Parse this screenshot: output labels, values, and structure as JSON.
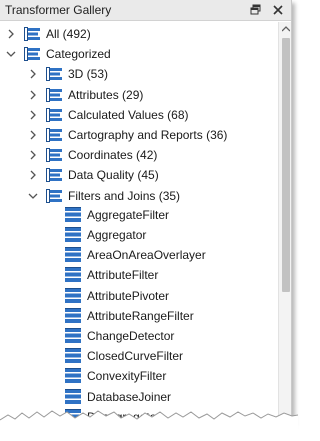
{
  "window": {
    "title": "Transformer Gallery",
    "pin_icon": "pin-icon",
    "close_icon": "close-icon"
  },
  "colors": {
    "icon_blue": "#2f72c4",
    "icon_dark": "#1d4f8e",
    "chevron": "#555555",
    "titlebar_bg": "#eaeaea"
  },
  "tree": {
    "all": {
      "label": "All (492)",
      "expanded": false
    },
    "categorized": {
      "label": "Categorized",
      "expanded": true,
      "categories": [
        {
          "label": "3D (53)",
          "expanded": false
        },
        {
          "label": "Attributes (29)",
          "expanded": false
        },
        {
          "label": "Calculated Values (68)",
          "expanded": false
        },
        {
          "label": "Cartography and Reports (36)",
          "expanded": false
        },
        {
          "label": "Coordinates (42)",
          "expanded": false
        },
        {
          "label": "Data Quality (45)",
          "expanded": false
        },
        {
          "label": "Filters and Joins (35)",
          "expanded": true
        }
      ],
      "transformers": [
        "AggregateFilter",
        "Aggregator",
        "AreaOnAreaOverlayer",
        "AttributeFilter",
        "AttributePivoter",
        "AttributeRangeFilter",
        "ChangeDetector",
        "ClosedCurveFilter",
        "ConvexityFilter",
        "DatabaseJoiner",
        "Deaggregator"
      ]
    }
  }
}
